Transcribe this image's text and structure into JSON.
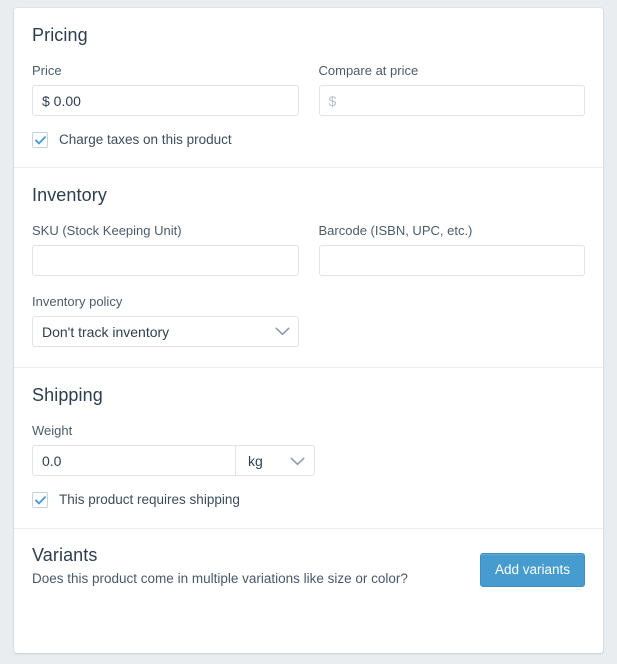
{
  "pricing": {
    "title": "Pricing",
    "price": {
      "label": "Price",
      "value": "$ 0.00",
      "placeholder": "$"
    },
    "compare_at_price": {
      "label": "Compare at price",
      "value": "",
      "placeholder": "$"
    },
    "charge_taxes": {
      "label": "Charge taxes on this product",
      "checked": true
    }
  },
  "inventory": {
    "title": "Inventory",
    "sku": {
      "label": "SKU (Stock Keeping Unit)",
      "value": "",
      "placeholder": ""
    },
    "barcode": {
      "label": "Barcode (ISBN, UPC, etc.)",
      "value": "",
      "placeholder": ""
    },
    "policy": {
      "label": "Inventory policy",
      "selected": "Don't track inventory",
      "icon": "chevron-down-icon"
    }
  },
  "shipping": {
    "title": "Shipping",
    "weight": {
      "label": "Weight",
      "value": "0.0",
      "placeholder": "0.0"
    },
    "weight_unit": {
      "selected": "kg",
      "icon": "chevron-down-icon"
    },
    "requires_shipping": {
      "label": "This product requires shipping",
      "checked": true
    }
  },
  "variants": {
    "title": "Variants",
    "subtitle": "Does this product come in multiple variations like size or color?",
    "add_button": "Add variants"
  },
  "colors": {
    "accent": "#479ccf",
    "checkbox_check": "#4a9cd6",
    "heading": "#2e3e4e",
    "label": "#4c5c6b",
    "border": "#dfe4e8",
    "divider": "#ebeef0",
    "page_background": "#e9edf0",
    "card_background": "#ffffff"
  }
}
